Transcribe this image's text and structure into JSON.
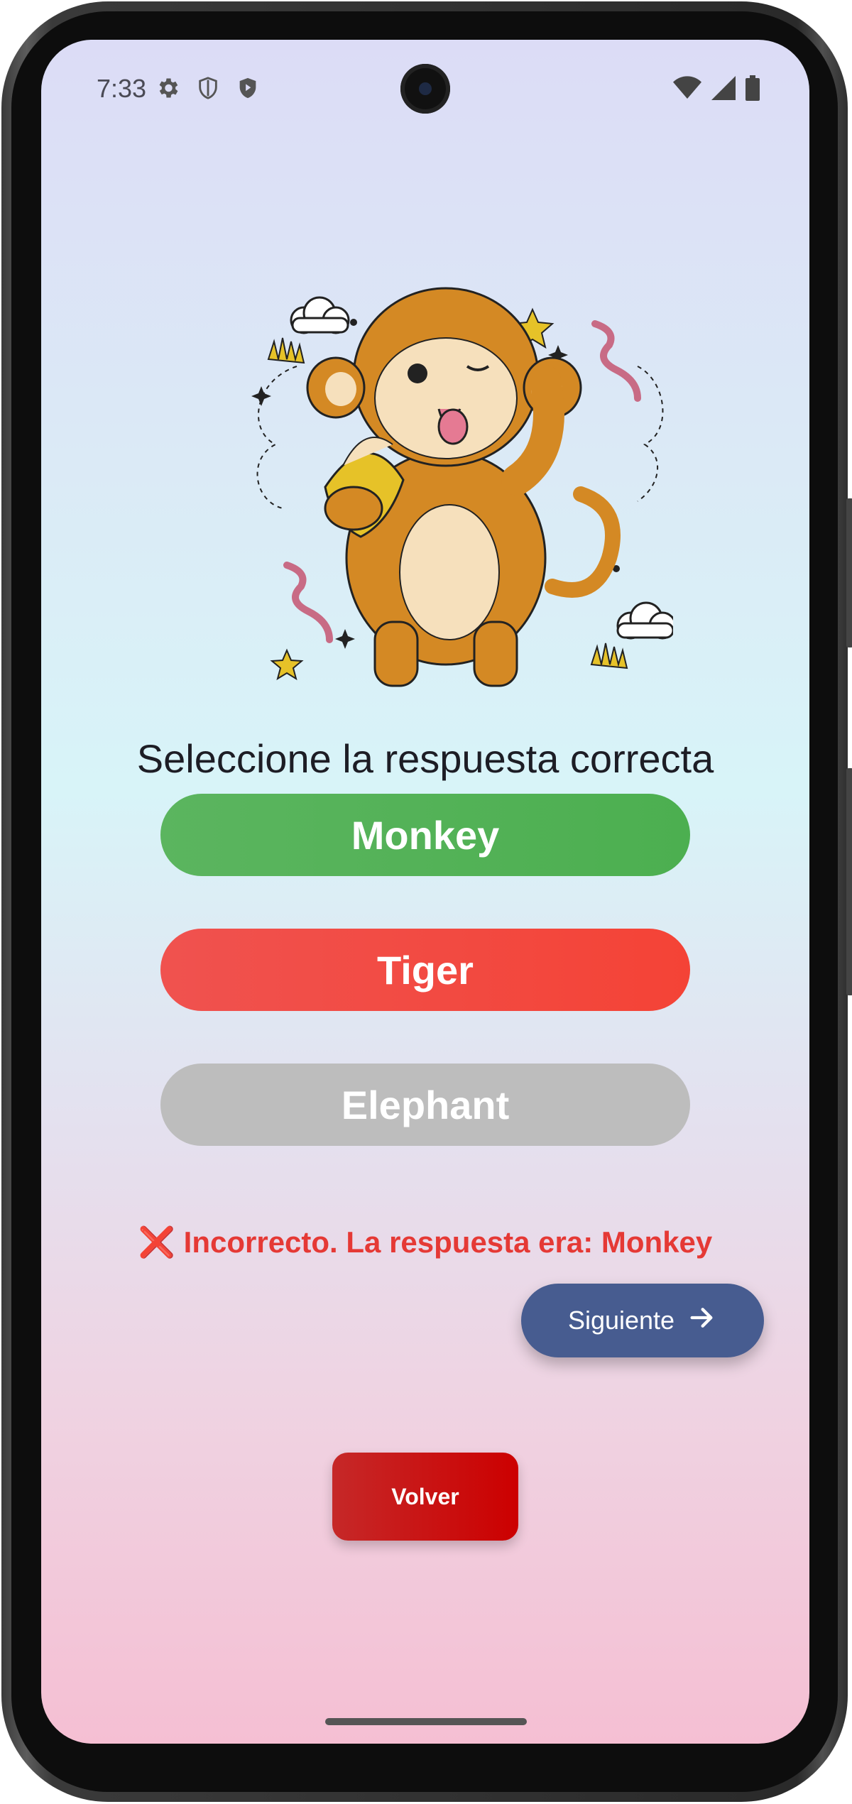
{
  "status_bar": {
    "time": "7:33",
    "left_icons": [
      "settings-icon",
      "shield-outline-icon",
      "shield-play-icon"
    ],
    "right_icons": [
      "wifi-icon",
      "signal-icon",
      "battery-icon"
    ]
  },
  "quiz": {
    "illustration": "monkey-eating-banana",
    "question": "Seleccione la respuesta correcta",
    "options": [
      {
        "label": "Monkey",
        "state": "correct",
        "color": "#4caf50"
      },
      {
        "label": "Tiger",
        "state": "selected-wrong",
        "color": "#f44336"
      },
      {
        "label": "Elephant",
        "state": "disabled",
        "color": "#bdbdbd"
      }
    ],
    "feedback_icon": "❌",
    "feedback_text": "Incorrecto. La respuesta era: Monkey",
    "feedback_color": "#e53935"
  },
  "actions": {
    "next_label": "Siguiente",
    "next_icon": "arrow-right-icon",
    "next_color": "#475c90",
    "back_label": "Volver",
    "back_color": "#cc0000"
  }
}
